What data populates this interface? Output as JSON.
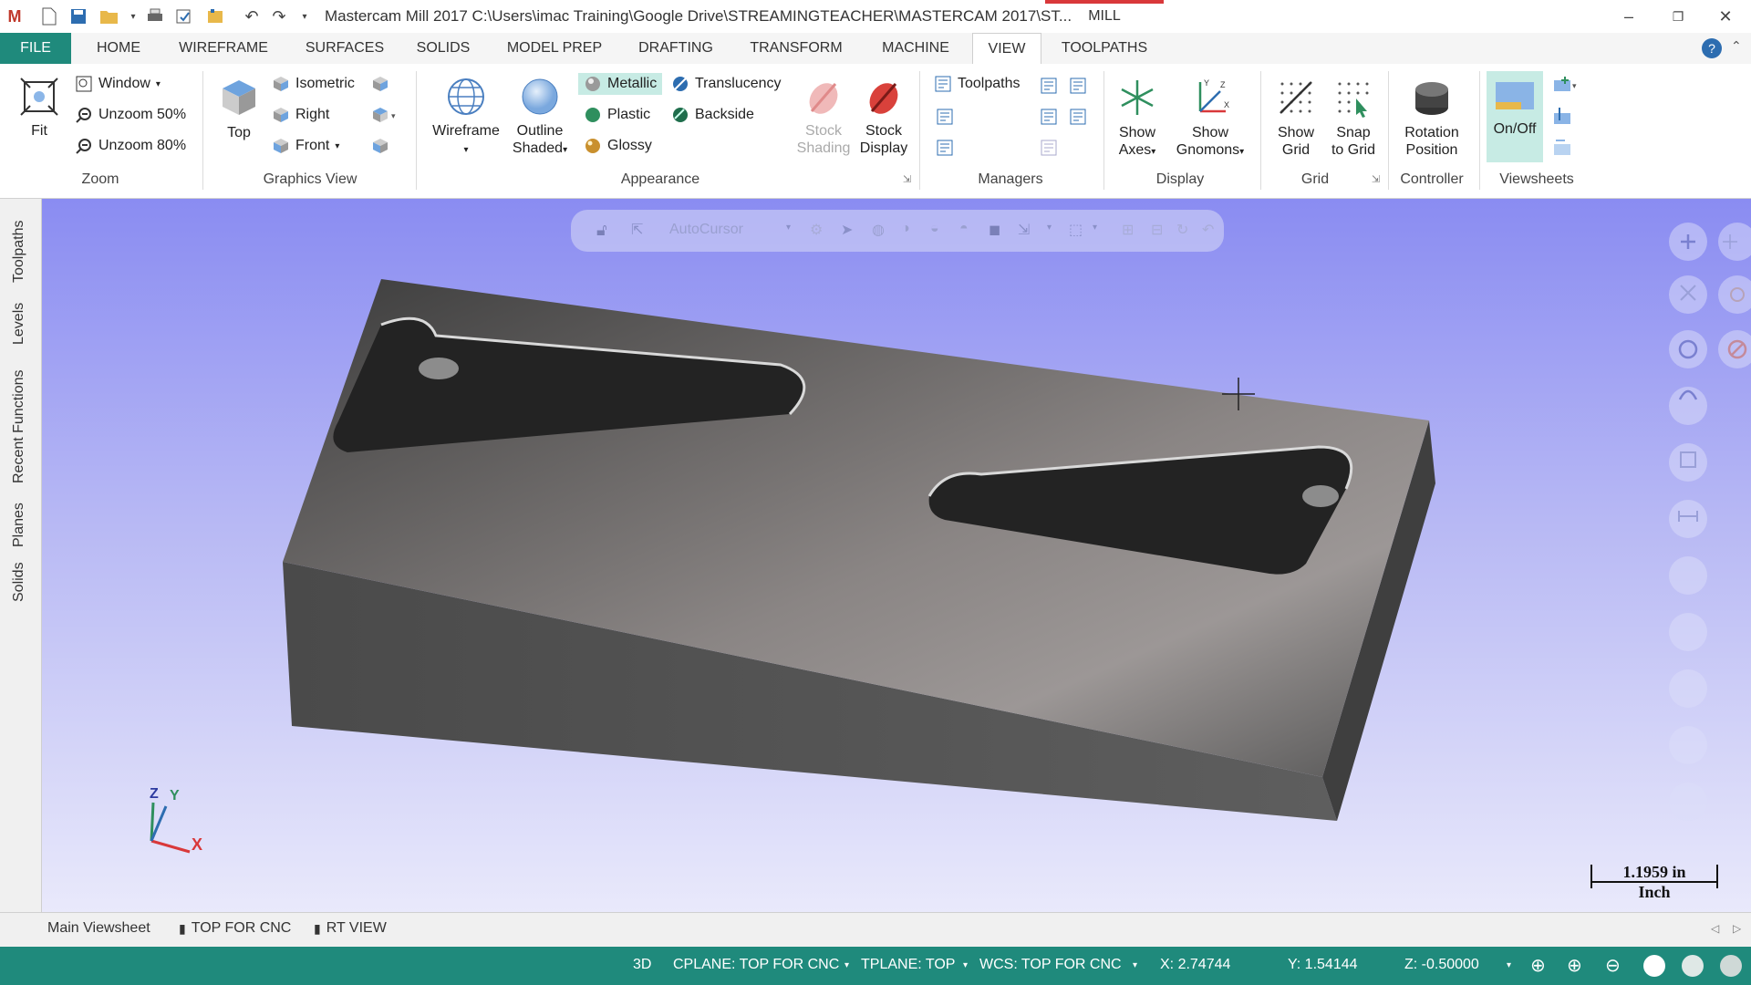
{
  "app": {
    "title": "Mastercam Mill 2017  C:\\Users\\imac Training\\Google Drive\\STREAMINGTEACHER\\MASTERCAM 2017\\ST...",
    "context_tab": "MILL"
  },
  "menu_tabs": [
    {
      "label": "FILE"
    },
    {
      "label": "HOME"
    },
    {
      "label": "WIREFRAME"
    },
    {
      "label": "SURFACES"
    },
    {
      "label": "SOLIDS"
    },
    {
      "label": "MODEL PREP"
    },
    {
      "label": "DRAFTING"
    },
    {
      "label": "TRANSFORM"
    },
    {
      "label": "MACHINE"
    },
    {
      "label": "VIEW"
    },
    {
      "label": "TOOLPATHS"
    }
  ],
  "ribbon": {
    "zoom": {
      "group": "Zoom",
      "fit": "Fit",
      "window": "Window",
      "unzoom50": "Unzoom 50%",
      "unzoom80": "Unzoom 80%"
    },
    "graphics_view": {
      "group": "Graphics View",
      "top": "Top",
      "isometric": "Isometric",
      "right": "Right",
      "front": "Front"
    },
    "appearance": {
      "group": "Appearance",
      "wireframe": "Wireframe",
      "outline_shaded_1": "Outline",
      "outline_shaded_2": "Shaded",
      "metallic": "Metallic",
      "plastic": "Plastic",
      "glossy": "Glossy",
      "translucency": "Translucency",
      "backside": "Backside",
      "stock_shading_1": "Stock",
      "stock_shading_2": "Shading",
      "stock_display_1": "Stock",
      "stock_display_2": "Display"
    },
    "managers": {
      "group": "Managers",
      "toolpaths": "Toolpaths"
    },
    "display": {
      "group": "Display",
      "show_axes_1": "Show",
      "show_axes_2": "Axes",
      "show_gnomons_1": "Show",
      "show_gnomons_2": "Gnomons"
    },
    "grid": {
      "group": "Grid",
      "show_grid_1": "Show",
      "show_grid_2": "Grid",
      "snap_grid_1": "Snap",
      "snap_grid_2": "to Grid"
    },
    "controller": {
      "group": "Controller",
      "rotation_1": "Rotation",
      "rotation_2": "Position"
    },
    "viewsheets": {
      "group": "Viewsheets",
      "onoff": "On/Off"
    }
  },
  "left_dock": [
    "Toolpaths",
    "Levels",
    "Recent Functions",
    "Planes",
    "Solids"
  ],
  "viewport": {
    "autocursor": "AutoCursor",
    "axes": {
      "z": "Z",
      "y": "Y",
      "x": "X"
    },
    "scale": {
      "value": "1.1959 in",
      "unit": "Inch"
    }
  },
  "viewsheets": [
    "Main Viewsheet",
    "TOP FOR CNC",
    "RT VIEW"
  ],
  "status": {
    "mode": "3D",
    "cplane": "CPLANE: TOP FOR CNC",
    "tplane": "TPLANE: TOP",
    "wcs": "WCS: TOP FOR CNC",
    "x": "X:  2.74744",
    "y": "Y:  1.54144",
    "z": "Z:  -0.50000"
  },
  "colors": {
    "accent": "#1f8a7c",
    "mill_tab": "#d9383a",
    "part": "#5a5a5a"
  }
}
